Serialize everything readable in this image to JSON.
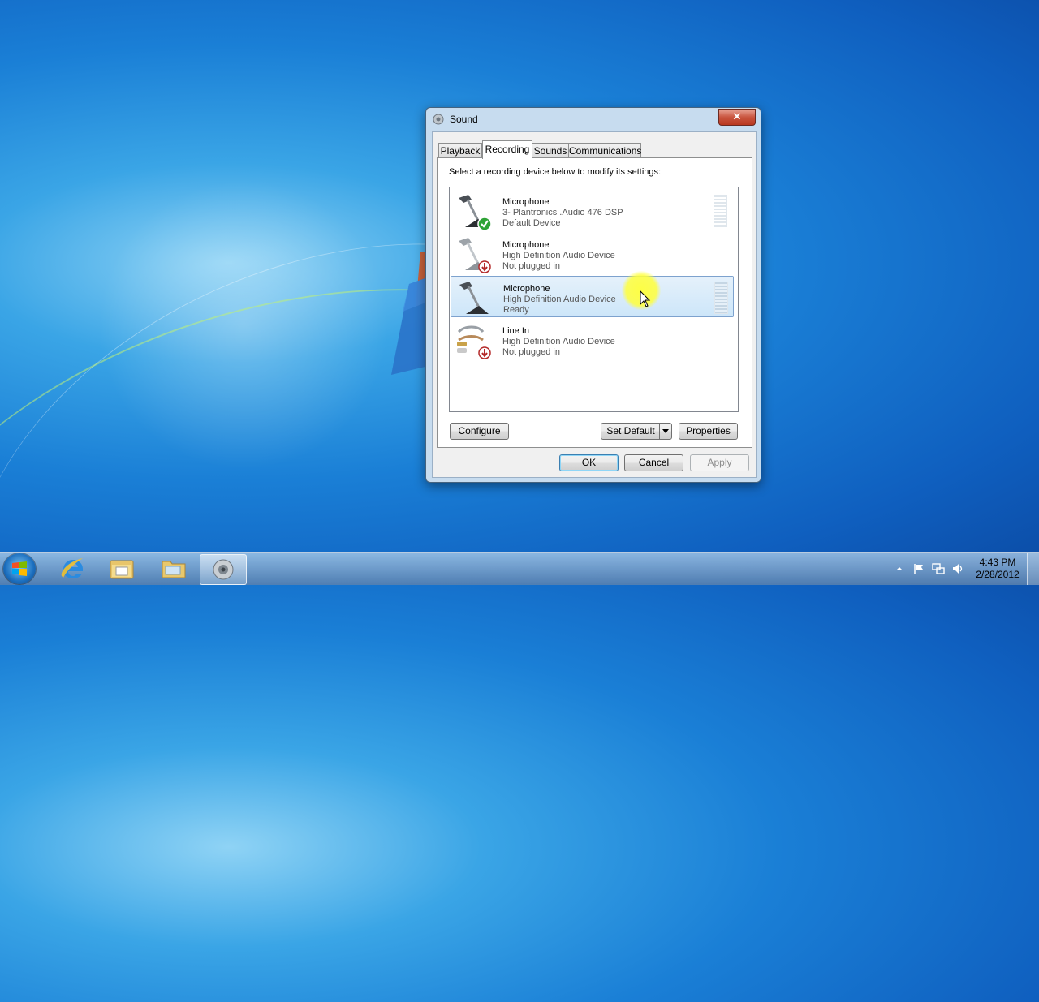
{
  "window": {
    "title": "Sound",
    "close_symbol": "✕"
  },
  "tabs": [
    {
      "label": "Playback"
    },
    {
      "label": "Recording"
    },
    {
      "label": "Sounds"
    },
    {
      "label": "Communications"
    }
  ],
  "active_tab": "Recording",
  "recording": {
    "instruction": "Select a recording device below to modify its settings:",
    "devices": [
      {
        "name": "Microphone",
        "description": "3- Plantronics .Audio 476 DSP",
        "status": "Default Device",
        "icon": "microphone-default-icon"
      },
      {
        "name": "Microphone",
        "description": "High Definition Audio Device",
        "status": "Not plugged in",
        "icon": "microphone-unplugged-icon"
      },
      {
        "name": "Microphone",
        "description": "High Definition Audio Device",
        "status": "Ready",
        "icon": "microphone-icon"
      },
      {
        "name": "Line In",
        "description": "High Definition Audio Device",
        "status": "Not plugged in",
        "icon": "line-in-unplugged-icon"
      }
    ],
    "selected_index": 2,
    "configure_label": "Configure",
    "set_default_label": "Set Default",
    "properties_label": "Properties"
  },
  "buttons": {
    "ok": "OK",
    "cancel": "Cancel",
    "apply": "Apply"
  },
  "taskbar": {
    "items": [
      {
        "icon": "internet-explorer-icon"
      },
      {
        "icon": "file-explorer-icon"
      },
      {
        "icon": "folder-icon"
      },
      {
        "icon": "sound-icon"
      }
    ],
    "tray_icons": [
      "show-hidden-icons-icon",
      "action-center-flag-icon",
      "network-icon",
      "volume-icon"
    ],
    "clock_time": "4:43 PM",
    "clock_date": "2/28/2012"
  },
  "colors": {
    "selection": "#cde6f9",
    "close_button": "#c9553f",
    "cursor_highlight": "#ffff3c"
  }
}
